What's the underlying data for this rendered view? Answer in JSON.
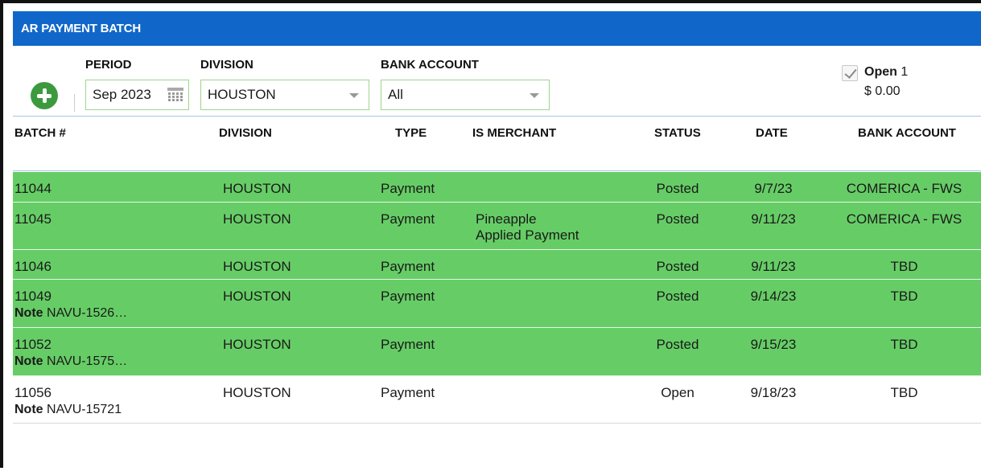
{
  "panel": {
    "title": "AR PAYMENT BATCH"
  },
  "filters": {
    "period_label": "PERIOD",
    "period_value": "Sep 2023",
    "division_label": "DIVISION",
    "division_value": "HOUSTON",
    "bank_label": "BANK ACCOUNT",
    "bank_value": "All"
  },
  "open_summary": {
    "label": "Open",
    "count": "1",
    "amount": "$ 0.00",
    "checked": true
  },
  "table": {
    "headers": [
      "BATCH #",
      "DIVISION",
      "TYPE",
      "IS MERCHANT",
      "STATUS",
      "DATE",
      "BANK ACCOUNT"
    ],
    "rows": [
      {
        "batch": "11044",
        "note_label": "",
        "note": "",
        "division": "HOUSTON",
        "type": "Payment",
        "merchant1": "",
        "merchant2": "",
        "status": "Posted",
        "date": "9/7/23",
        "bank": "COMERICA - FWS",
        "color": "#66cd66"
      },
      {
        "batch": "11045",
        "note_label": "",
        "note": "",
        "division": "HOUSTON",
        "type": "Payment",
        "merchant1": "Pineapple",
        "merchant2": "Applied Payment",
        "status": "Posted",
        "date": "9/11/23",
        "bank": "COMERICA - FWS",
        "color": "#66cd66"
      },
      {
        "batch": "11046",
        "note_label": "",
        "note": "",
        "division": "HOUSTON",
        "type": "Payment",
        "merchant1": "",
        "merchant2": "",
        "status": "Posted",
        "date": "9/11/23",
        "bank": "TBD",
        "color": "#66cd66"
      },
      {
        "batch": "11049",
        "note_label": "Note",
        "note": "NAVU-1526…",
        "division": "HOUSTON",
        "type": "Payment",
        "merchant1": "",
        "merchant2": "",
        "status": "Posted",
        "date": "9/14/23",
        "bank": "TBD",
        "color": "#66cd66"
      },
      {
        "batch": "11052",
        "note_label": "Note",
        "note": "NAVU-1575…",
        "division": "HOUSTON",
        "type": "Payment",
        "merchant1": "",
        "merchant2": "",
        "status": "Posted",
        "date": "9/15/23",
        "bank": "TBD",
        "color": "#66cd66"
      },
      {
        "batch": "11056",
        "note_label": "Note",
        "note": "NAVU-15721",
        "division": "HOUSTON",
        "type": "Payment",
        "merchant1": "",
        "merchant2": "",
        "status": "Open",
        "date": "9/18/23",
        "bank": "TBD",
        "color": "#ffffff"
      }
    ]
  },
  "colors": {
    "header_blue": "#1167c9",
    "posted_green": "#66cd66",
    "add_button_green": "#3c9a3e"
  },
  "icons": {
    "add": "plus-circle-icon",
    "calendar": "calendar-icon",
    "dropdown": "chevron-down-icon",
    "checkbox": "checkbox-icon"
  }
}
